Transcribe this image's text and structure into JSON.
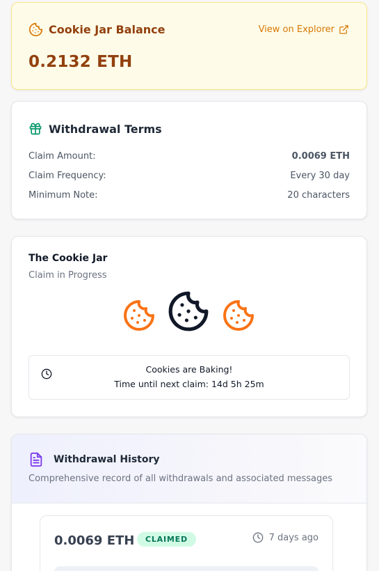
{
  "balance": {
    "title": "Cookie Jar Balance",
    "explorer_label": "View on Explorer",
    "amount": "0.2132 ETH"
  },
  "terms": {
    "title": "Withdrawal Terms",
    "rows": [
      {
        "label": "Claim Amount:",
        "value": "0.0069 ETH"
      },
      {
        "label": "Claim Frequency:",
        "value": "Every 30 day"
      },
      {
        "label": "Minimum Note:",
        "value": "20 characters"
      }
    ]
  },
  "jar": {
    "title": "The Cookie Jar",
    "subtitle": "Claim in Progress",
    "status_line1": "Cookies are Baking!",
    "status_line2": "Time until next claim: 14d 5h 25m"
  },
  "history": {
    "title": "Withdrawal History",
    "subtitle": "Comprehensive record of all withdrawals and associated messages",
    "entries": [
      {
        "amount": "0.0069 ETH",
        "status": "CLAIMED",
        "time": "7 days ago"
      }
    ]
  },
  "colors": {
    "accent": "#d97706",
    "brown": "#92400e",
    "cookie_orange": "#f97316",
    "success_bg": "#d1fae5",
    "success_text": "#047857"
  },
  "icons": {
    "balance": "cookie-icon",
    "explorer": "external-link-icon",
    "terms": "gift-icon",
    "jar": "cookie-icon",
    "status": "clock-icon",
    "history": "file-text-icon",
    "entry_time": "clock-icon"
  }
}
